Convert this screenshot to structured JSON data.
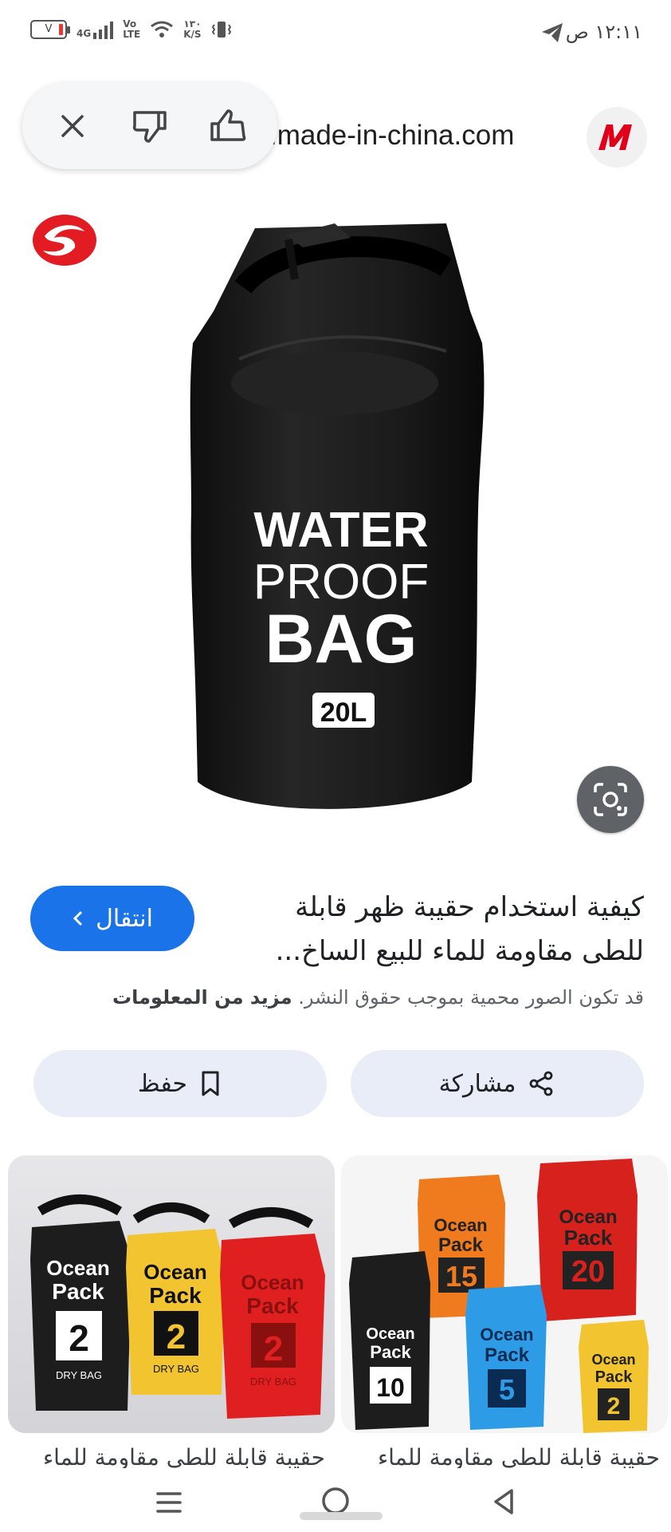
{
  "status_bar": {
    "time": "١٢:١١ ص",
    "network": "4G",
    "volte": "Vo\nLTE",
    "speed_value": "١٣٠",
    "speed_unit": "K/S",
    "battery_label": "V"
  },
  "header": {
    "source_domain": ".made-in-china.com",
    "source_logo_letter": "M",
    "feedback": {
      "close": "close",
      "dislike": "thumb-down",
      "like": "thumb-up"
    }
  },
  "image": {
    "bag_line1": "WATER",
    "bag_line2": "PROOF",
    "bag_line3": "BAG",
    "bag_capacity": "20L"
  },
  "result": {
    "title": "كيفية استخدام حقيبة ظهر قابلة للطى مقاومة للماء للبيع الساخ...",
    "visit_label": "انتقال",
    "copyright_text": "قد تكون الصور محمية بموجب حقوق النشر.",
    "more_info": "مزيد من المعلومات",
    "share_label": "مشاركة",
    "save_label": "حفظ"
  },
  "related": [
    {
      "caption": "حقيبة قابلة للطى مقاومة للماء",
      "brand1": "Ocean",
      "brand2": "Pack",
      "dry": "DRY BAG",
      "sizes": [
        "2",
        "2",
        "2"
      ]
    },
    {
      "caption": "حقيبة قابلة للطى مقاومة للماء",
      "brand1": "Ocean",
      "brand2": "Pack",
      "dry": "DRY BAG",
      "sizes": [
        "15",
        "20",
        "10",
        "5",
        "2"
      ]
    }
  ],
  "colors": {
    "accent": "#1a73e8",
    "pill": "#e8edf8",
    "bag": "#1c1c1c"
  }
}
